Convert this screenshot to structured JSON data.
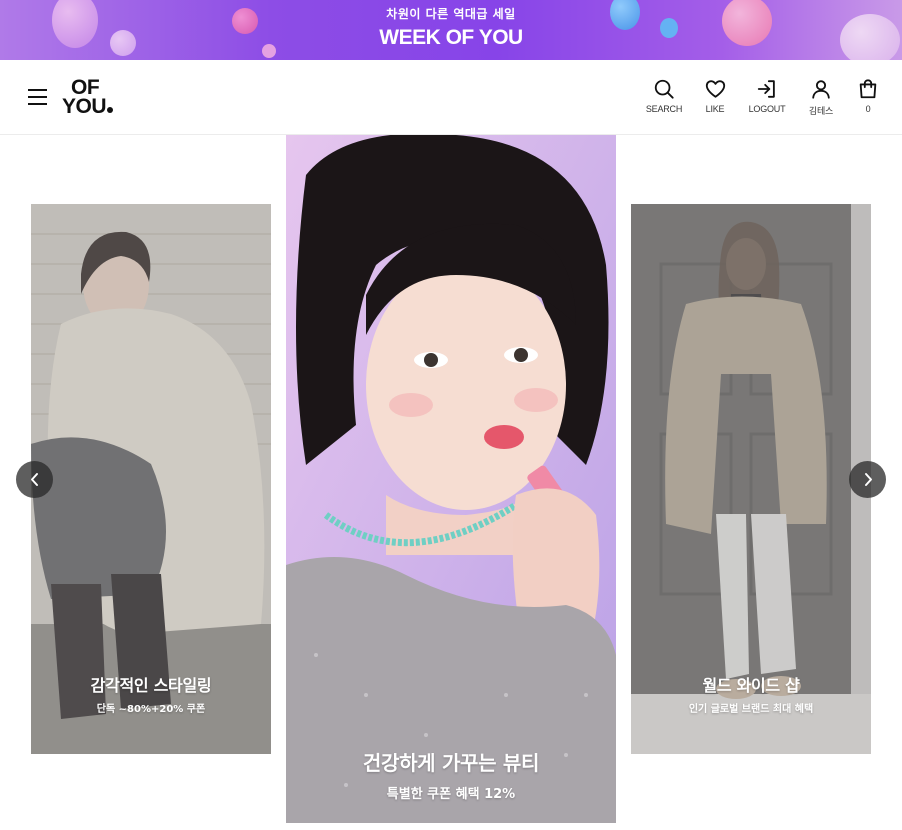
{
  "banner": {
    "subtitle": "차원이 다른 역대급 세일",
    "title": "WEEK OF YOU"
  },
  "header": {
    "logo_line1": "OF",
    "logo_line2": "YOU",
    "nav": {
      "search": "SEARCH",
      "like": "LIKE",
      "logout": "LOGOUT",
      "user": "김테스",
      "cart_count": "0"
    }
  },
  "carousel": {
    "slides": [
      {
        "title": "감각적인 스타일링",
        "subtitle": "단독 ~80%+20% 쿠폰"
      },
      {
        "title": "건강하게 가꾸는 뷰티",
        "subtitle": "특별한 쿠폰 혜택 12%"
      },
      {
        "title": "월드 와이드 샵",
        "subtitle": "인기 글로벌 브랜드 최대 혜택"
      }
    ]
  },
  "colors": {
    "banner_purple": "#8744e8",
    "text_dark": "#111111",
    "arrow_bg": "#333333"
  },
  "icons": [
    "menu-icon",
    "search-icon",
    "heart-icon",
    "logout-icon",
    "user-icon",
    "shopping-bag-icon",
    "chevron-left-icon",
    "chevron-right-icon"
  ]
}
